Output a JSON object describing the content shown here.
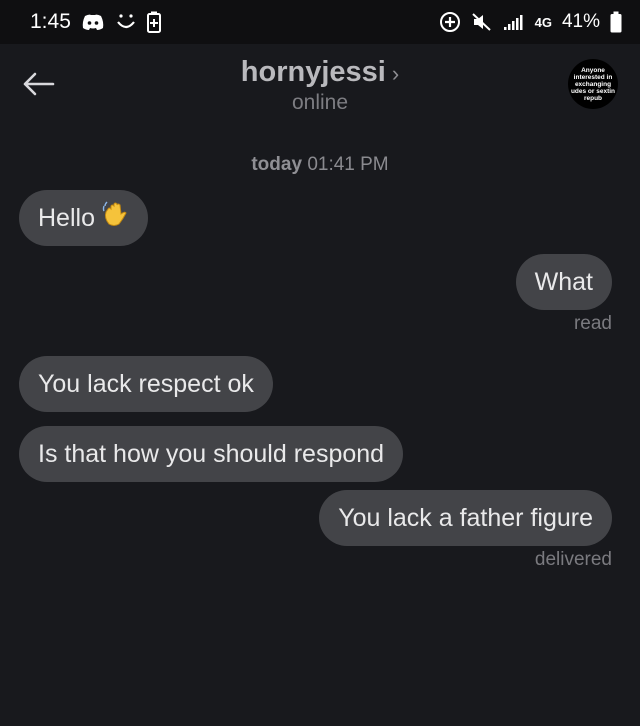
{
  "status_bar": {
    "time": "1:45",
    "network": "4G",
    "battery": "41%",
    "icons": [
      "discord-icon",
      "smile-icon",
      "battery-saver-icon",
      "data-saver-icon",
      "mute-icon",
      "signal-icon",
      "battery-icon"
    ]
  },
  "header": {
    "contact_name": "hornyjessi",
    "chevron": "›",
    "presence": "online",
    "avatar_text": "Anyone\ninterested in\nexchanging\nudes or sextin\nrepub"
  },
  "chat": {
    "timestamp_day": "today",
    "timestamp_time": "01:41 PM",
    "messages": [
      {
        "direction": "in",
        "text": "Hello",
        "emoji": "waving-hand-icon"
      },
      {
        "direction": "out",
        "text": "What",
        "receipt": "read"
      },
      {
        "direction": "in",
        "text": "You lack respect ok"
      },
      {
        "direction": "in",
        "text": "Is that how you should respond"
      },
      {
        "direction": "out",
        "text": "You lack a father figure",
        "receipt": "delivered"
      }
    ]
  },
  "colors": {
    "background": "#18191d",
    "status_bar": "#0f0f11",
    "bubble": "#434448",
    "text": "#e9e9ea",
    "muted": "#7a7a7f"
  }
}
